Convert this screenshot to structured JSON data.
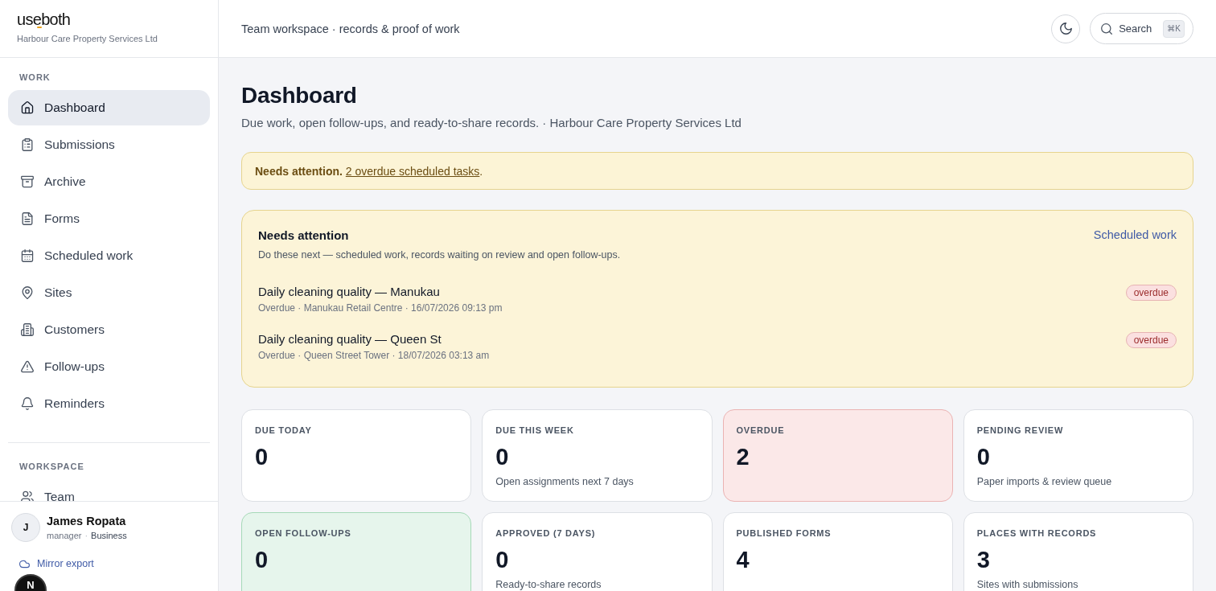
{
  "sidebar": {
    "logo": "useboth",
    "org": "Harbour Care Property Services Ltd",
    "sections": [
      {
        "label": "WORK",
        "items": [
          {
            "label": "Dashboard",
            "selected": true
          },
          {
            "label": "Submissions",
            "selected": false
          },
          {
            "label": "Archive",
            "selected": false
          },
          {
            "label": "Forms",
            "selected": false
          },
          {
            "label": "Scheduled work",
            "selected": false
          },
          {
            "label": "Sites",
            "selected": false
          },
          {
            "label": "Customers",
            "selected": false
          },
          {
            "label": "Follow-ups",
            "selected": false
          },
          {
            "label": "Reminders",
            "selected": false
          }
        ]
      },
      {
        "label": "WORKSPACE",
        "items": [
          {
            "label": "Team",
            "selected": false
          }
        ]
      }
    ],
    "user": {
      "initial": "J",
      "name": "James Ropata",
      "role": "manager",
      "separator": "·",
      "plan": "Business"
    },
    "mirror_export": "Mirror export"
  },
  "floating_button": {
    "label": "N"
  },
  "header": {
    "title": "Team workspace · records & proof of work",
    "search": {
      "label": "Search",
      "shortcut": "⌘K"
    }
  },
  "page": {
    "title": "Dashboard",
    "subtitle": "Due work, open follow-ups, and ready-to-share records. · Harbour Care Property Services Ltd"
  },
  "banner": {
    "lead": "Needs attention.",
    "link": "2 overdue scheduled tasks",
    "trail": "."
  },
  "attention": {
    "title": "Needs attention",
    "description": "Do these next — scheduled work, records waiting on review and open follow-ups.",
    "link": "Scheduled work",
    "items": [
      {
        "title": "Daily cleaning quality — Manukau",
        "meta": "Overdue · Manukau Retail Centre · 16/07/2026 09:13 pm",
        "badge": "overdue"
      },
      {
        "title": "Daily cleaning quality — Queen St",
        "meta": "Overdue · Queen Street Tower · 18/07/2026 03:13 am",
        "badge": "overdue"
      }
    ]
  },
  "stats": [
    {
      "kind": "plain",
      "label": "DUE TODAY",
      "value": "0"
    },
    {
      "kind": "plain",
      "label": "DUE THIS WEEK",
      "value": "0",
      "note": "Open assignments next 7 days"
    },
    {
      "kind": "danger",
      "label": "OVERDUE",
      "value": "2"
    },
    {
      "kind": "plain",
      "label": "PENDING REVIEW",
      "value": "0",
      "note": "Paper imports & review queue"
    },
    {
      "kind": "success",
      "label": "OPEN FOLLOW-UPS",
      "value": "0"
    },
    {
      "kind": "plain",
      "label": "APPROVED (7 DAYS)",
      "value": "0",
      "note": "Ready-to-share records"
    },
    {
      "kind": "plain",
      "label": "PUBLISHED FORMS",
      "value": "4"
    },
    {
      "kind": "plain",
      "label": "PLACES WITH RECORDS",
      "value": "3",
      "note": "Sites with submissions"
    }
  ]
}
